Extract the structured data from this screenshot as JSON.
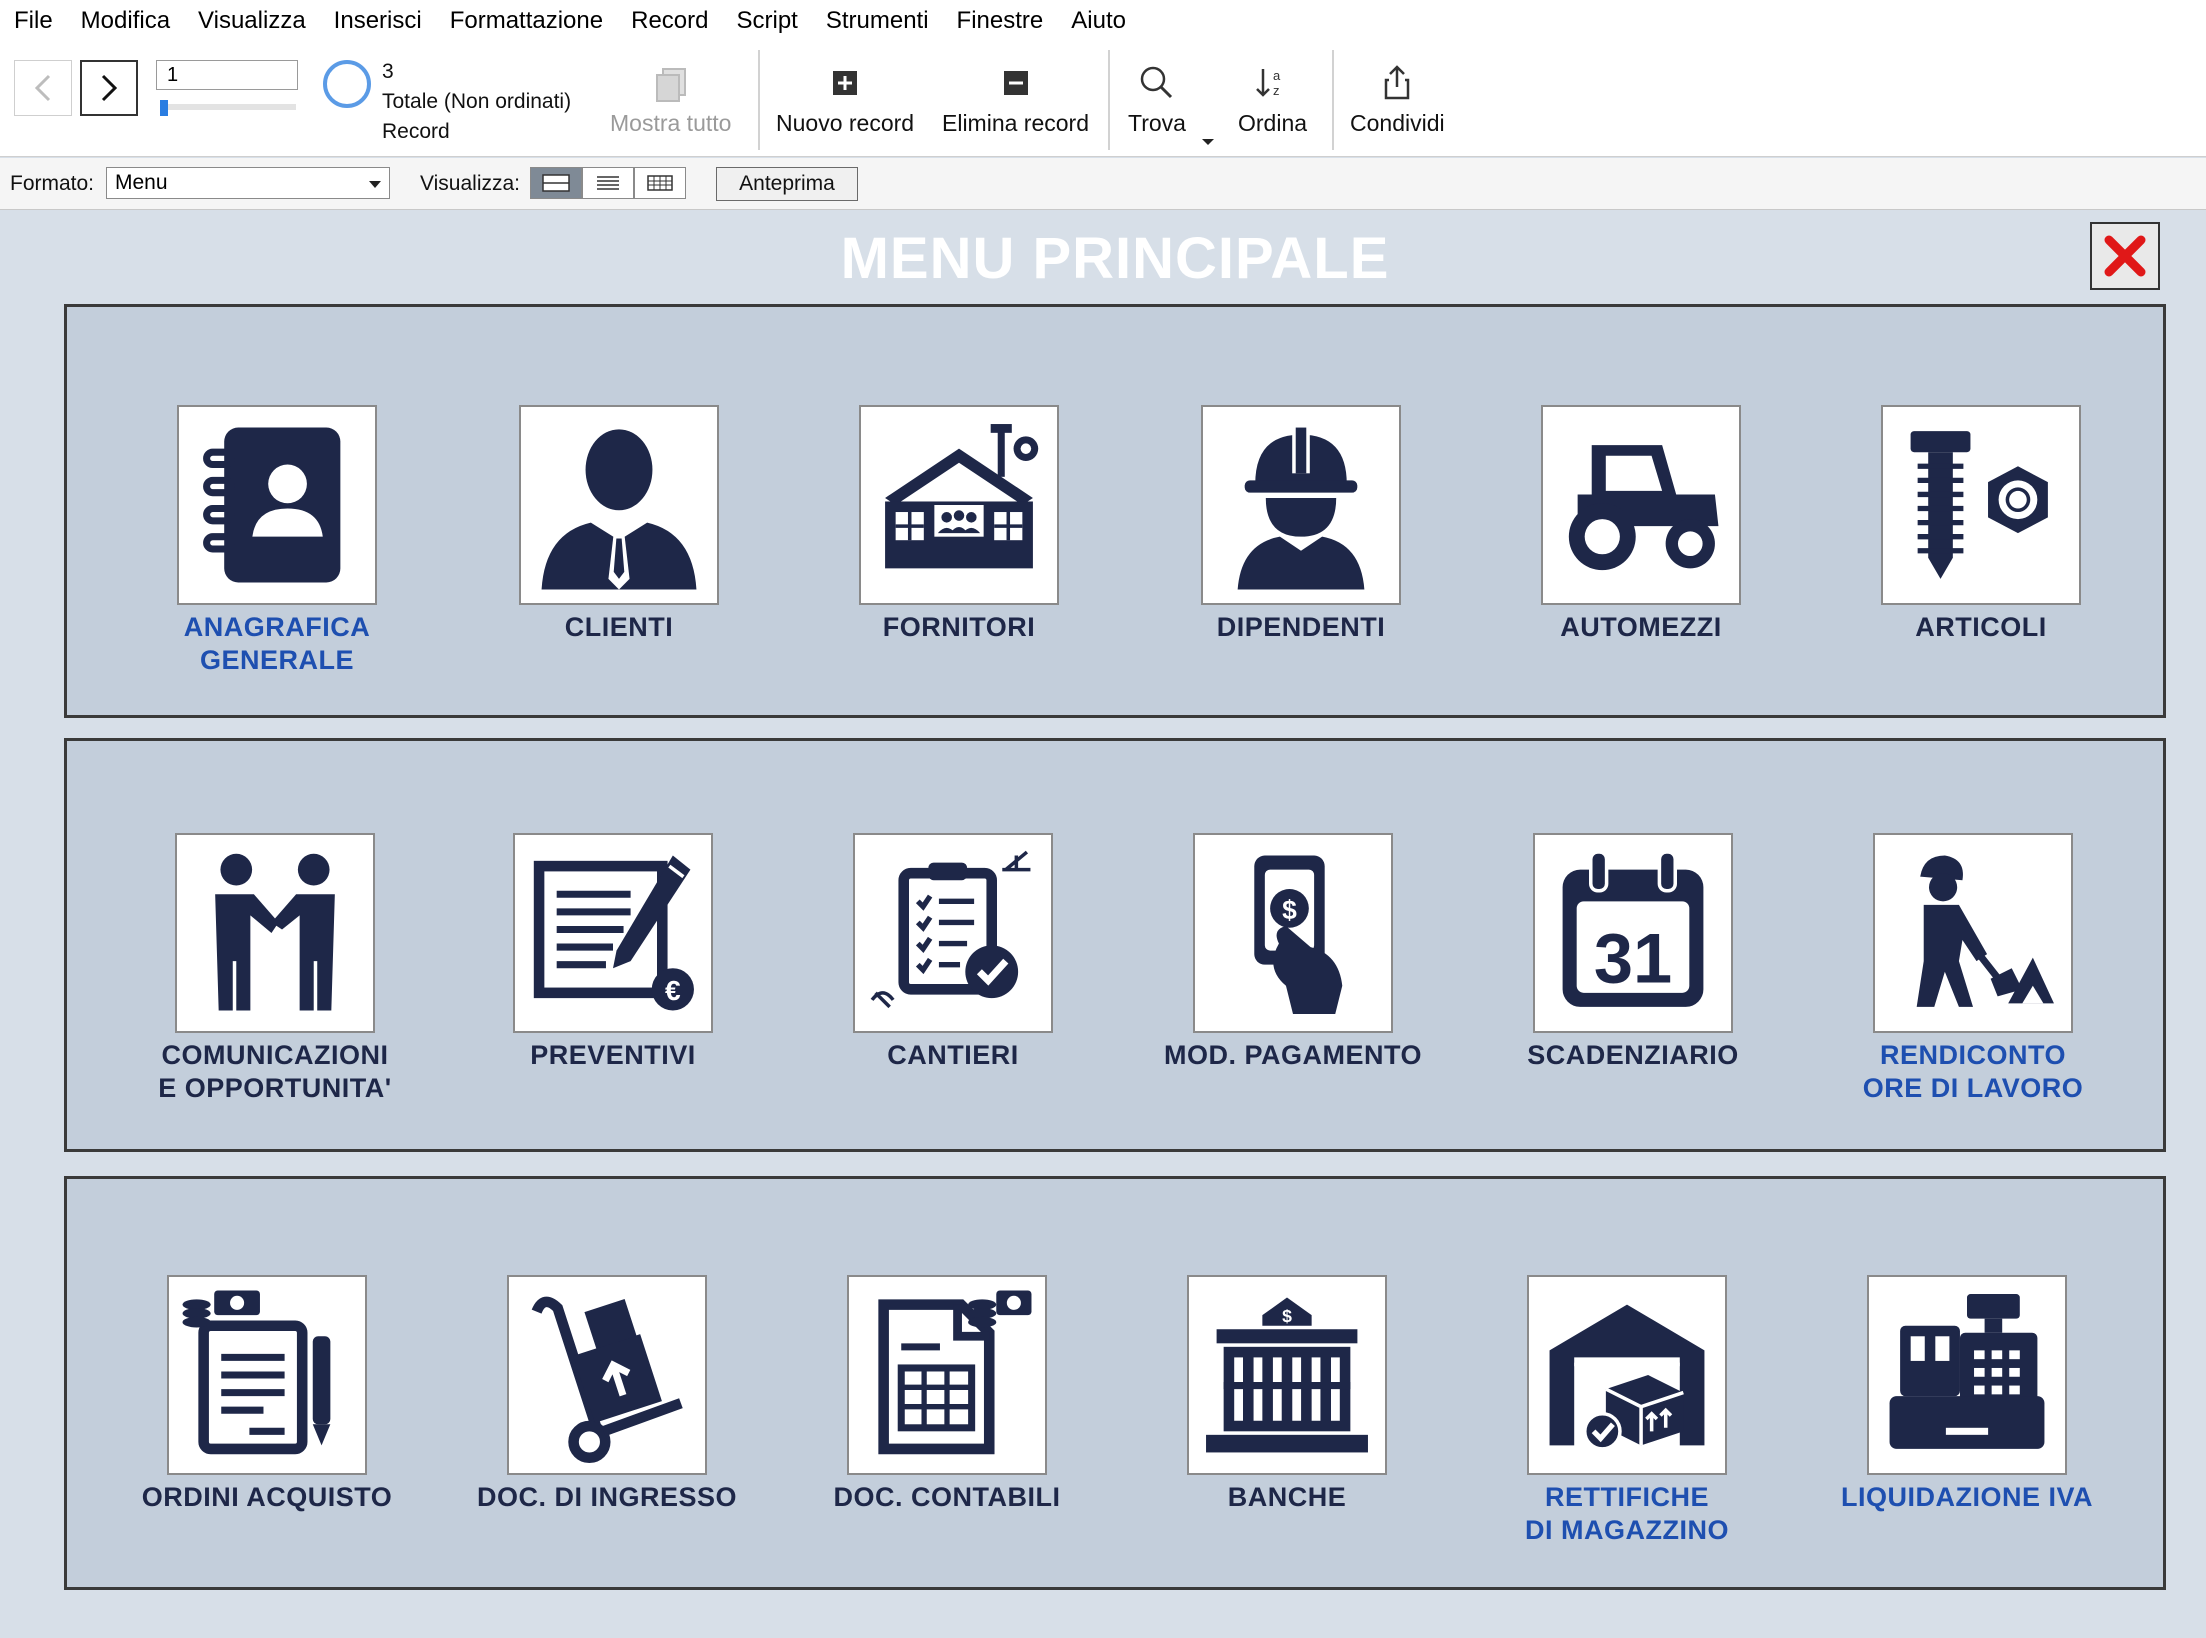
{
  "menubar": {
    "items": [
      "File",
      "Modifica",
      "Visualizza",
      "Inserisci",
      "Formattazione",
      "Record",
      "Script",
      "Strumenti",
      "Finestre",
      "Aiuto"
    ]
  },
  "toolbar": {
    "record_current": "1",
    "found_count": "3",
    "found_status": "Totale (Non ordinati)",
    "found_unit": "Record",
    "show_all": "Mostra tutto",
    "new_record": "Nuovo record",
    "delete_record": "Elimina record",
    "find": "Trova",
    "sort": "Ordina",
    "share": "Condividi"
  },
  "formatbar": {
    "layout_label": "Formato:",
    "layout_value": "Menu",
    "view_label": "Visualizza:",
    "preview": "Anteprima"
  },
  "page": {
    "title": "MENU PRINCIPALE"
  },
  "colors": {
    "icon": "#1e2748",
    "link_blue": "#1e4fb0",
    "panel": "#c3cedb",
    "background": "#d7dfe8",
    "close_red": "#e01818"
  },
  "rows": [
    [
      {
        "label1": "ANAGRAFICA",
        "label2": "GENERALE",
        "icon": "address-book-icon",
        "blue": true
      },
      {
        "label1": "CLIENTI",
        "label2": "",
        "icon": "businessman-icon",
        "blue": false
      },
      {
        "label1": "FORNITORI",
        "label2": "",
        "icon": "supplier-building-icon",
        "blue": false
      },
      {
        "label1": "DIPENDENTI",
        "label2": "",
        "icon": "worker-helmet-icon",
        "blue": false
      },
      {
        "label1": "AUTOMEZZI",
        "label2": "",
        "icon": "tractor-icon",
        "blue": false
      },
      {
        "label1": "ARTICOLI",
        "label2": "",
        "icon": "bolt-nut-icon",
        "blue": false
      }
    ],
    [
      {
        "label1": "COMUNICAZIONI",
        "label2": "E OPPORTUNITA'",
        "icon": "handshake-icon",
        "blue": false
      },
      {
        "label1": "PREVENTIVI",
        "label2": "",
        "icon": "quote-document-icon",
        "blue": false
      },
      {
        "label1": "CANTIERI",
        "label2": "",
        "icon": "clipboard-check-icon",
        "blue": false
      },
      {
        "label1": "MOD. PAGAMENTO",
        "label2": "",
        "icon": "payment-hand-icon",
        "blue": false
      },
      {
        "label1": "SCADENZIARIO",
        "label2": "",
        "icon": "calendar-icon",
        "blue": false
      },
      {
        "label1": "RENDICONTO",
        "label2": "ORE DI LAVORO",
        "icon": "worker-shovel-icon",
        "blue": true
      }
    ],
    [
      {
        "label1": "ORDINI ACQUISTO",
        "label2": "",
        "icon": "purchase-order-icon",
        "blue": false
      },
      {
        "label1": "DOC. DI INGRESSO",
        "label2": "",
        "icon": "hand-truck-icon",
        "blue": false
      },
      {
        "label1": "DOC. CONTABILI",
        "label2": "",
        "icon": "accounting-document-icon",
        "blue": false
      },
      {
        "label1": "BANCHE",
        "label2": "",
        "icon": "bank-icon",
        "blue": false
      },
      {
        "label1": "RETTIFICHE",
        "label2": "DI MAGAZZINO",
        "icon": "warehouse-icon",
        "blue": true
      },
      {
        "label1": "LIQUIDAZIONE IVA",
        "label2": "",
        "icon": "cash-register-icon",
        "blue": true
      }
    ]
  ]
}
